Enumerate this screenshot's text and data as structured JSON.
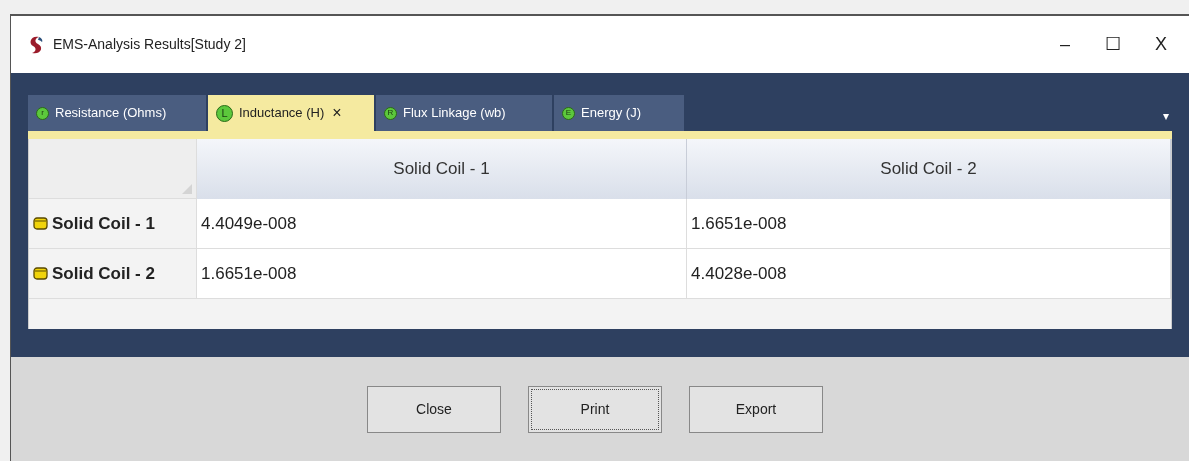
{
  "window": {
    "title": "EMS-Analysis Results[Study 2]",
    "controls": [
      "–",
      "☐",
      "X"
    ]
  },
  "tabs": [
    {
      "label": "Resistance (Ohms)",
      "badge": "r",
      "selected": false
    },
    {
      "label": "Inductance (H)",
      "badge": "L",
      "selected": true,
      "close": "×"
    },
    {
      "label": "Flux Linkage (wb)",
      "badge": "R",
      "selected": false
    },
    {
      "label": "Energy (J)",
      "badge": "E",
      "selected": false
    }
  ],
  "tab_menu": "▾",
  "table": {
    "columns": [
      "Solid Coil - 1",
      "Solid Coil - 2"
    ],
    "rows": [
      {
        "name": "Solid Coil - 1",
        "cells": [
          "4.4049e-008",
          "1.6651e-008"
        ]
      },
      {
        "name": "Solid Coil - 2",
        "cells": [
          "1.6651e-008",
          "4.4028e-008"
        ]
      }
    ]
  },
  "buttons": [
    {
      "label": "Close",
      "focused": false
    },
    {
      "label": "Print",
      "focused": true
    },
    {
      "label": "Export",
      "focused": false
    }
  ]
}
